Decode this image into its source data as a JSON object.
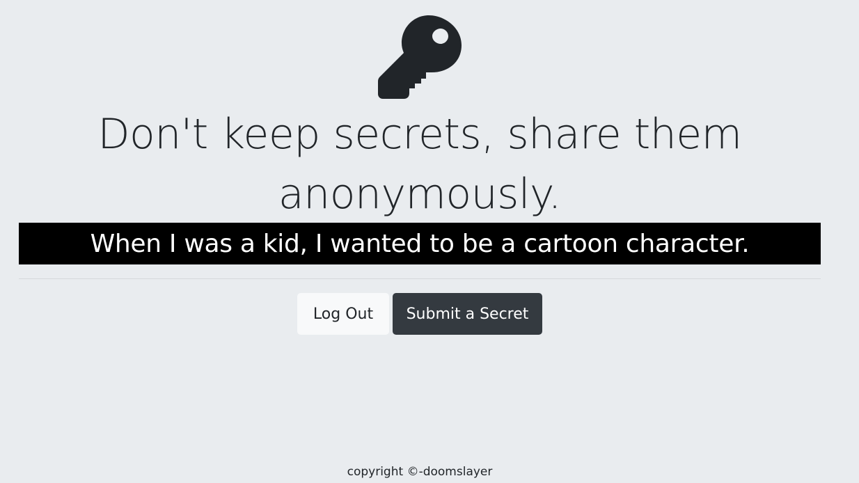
{
  "icon": "key-icon",
  "headline": "Don't keep secrets, share them anonymously.",
  "secret": "When I was a kid, I wanted to be a cartoon character.",
  "buttons": {
    "logout_label": "Log Out",
    "submit_label": "Submit a Secret"
  },
  "footer": "copyright ©-doomslayer",
  "colors": {
    "background": "#e9ecef",
    "secret_bar": "#000000",
    "dark_button": "#343a40",
    "light_button": "#f8f9fa"
  }
}
